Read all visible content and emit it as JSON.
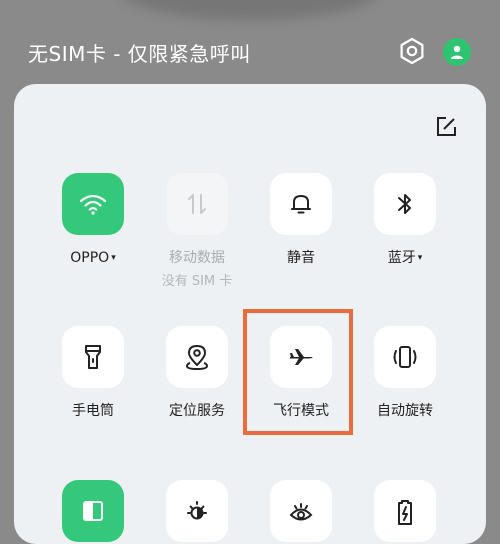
{
  "status": {
    "title": "无SIM卡 - 仅限紧急呼叫"
  },
  "header_icons": {
    "settings": "gear-icon",
    "user": "user-icon"
  },
  "colors": {
    "accent": "#34c97a",
    "highlight": "#ea6c3c"
  },
  "tiles": [
    {
      "label": "OPPO",
      "caret": "▾",
      "icon": "wifi-icon",
      "state": "on"
    },
    {
      "label": "移动数据",
      "sub": "没有 SIM 卡",
      "icon": "mobile-data-icon",
      "state": "disabled"
    },
    {
      "label": "静音",
      "icon": "bell-icon",
      "state": "off"
    },
    {
      "label": "蓝牙",
      "caret": "▾",
      "icon": "bluetooth-icon",
      "state": "off"
    },
    {
      "label": "手电筒",
      "icon": "flashlight-icon",
      "state": "off"
    },
    {
      "label": "定位服务",
      "icon": "location-icon",
      "state": "off"
    },
    {
      "label": "飞行模式",
      "icon": "airplane-icon",
      "state": "off"
    },
    {
      "label": "自动旋转",
      "icon": "rotate-icon",
      "state": "off"
    },
    {
      "label": "",
      "icon": "split-screen-icon",
      "state": "on"
    },
    {
      "label": "",
      "icon": "brightness-icon",
      "state": "off"
    },
    {
      "label": "",
      "icon": "eye-icon",
      "state": "off"
    },
    {
      "label": "",
      "icon": "battery-saver-icon",
      "state": "off"
    }
  ]
}
